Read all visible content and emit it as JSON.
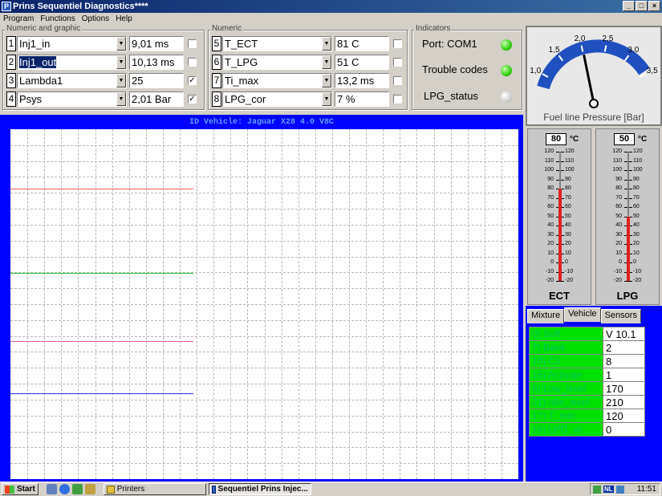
{
  "window": {
    "title": "Prins Sequentiel Diagnostics****",
    "title_icon_letter": "P",
    "min": "_",
    "max": "□",
    "close": "×"
  },
  "menu": [
    "Program",
    "Functions",
    "Options",
    "Help"
  ],
  "numeric_graphic": {
    "label": "Numeric and graphic",
    "rows": [
      {
        "idx": "1",
        "name": "Inj1_in",
        "value": "9,01 ms",
        "checked": false,
        "selected": false
      },
      {
        "idx": "2",
        "name": "Inj1_out",
        "value": "10,13 ms",
        "checked": false,
        "selected": true
      },
      {
        "idx": "3",
        "name": "Lambda1",
        "value": "25",
        "checked": true,
        "selected": false
      },
      {
        "idx": "4",
        "name": "Psys",
        "value": "2,01 Bar",
        "checked": true,
        "selected": false
      }
    ]
  },
  "numeric": {
    "label": "Numeric",
    "rows": [
      {
        "idx": "5",
        "name": "T_ECT",
        "value": "81 C",
        "checked": false
      },
      {
        "idx": "6",
        "name": "T_LPG",
        "value": "51 C",
        "checked": false
      },
      {
        "idx": "7",
        "name": "Ti_max",
        "value": "13,2 ms",
        "checked": false
      },
      {
        "idx": "8",
        "name": "LPG_cor",
        "value": "7 %",
        "checked": false
      }
    ]
  },
  "indicators": {
    "label": "Indicators",
    "items": [
      {
        "label": "Port: COM1",
        "state": "green"
      },
      {
        "label": "Trouble codes",
        "state": "green"
      },
      {
        "label": "LPG_status",
        "state": "off"
      }
    ]
  },
  "gauge": {
    "label": "Fuel line Pressure [Bar]",
    "ticks": [
      "1,0",
      "1,5",
      "2,0",
      "2,5",
      "3,0",
      "3,5"
    ],
    "value": 2.01,
    "min": 1.0,
    "max": 3.5
  },
  "chart": {
    "title": "ID Vehicle: Jaguar X28 4.0 V8C",
    "colors": {
      "bg": "#0000ff",
      "red": "#ff6060",
      "green": "#30c030",
      "pink": "#e060a0",
      "blue": "#3030e0"
    },
    "traces": [
      {
        "color": "red",
        "level": 0.83
      },
      {
        "color": "green",
        "level": 0.59
      },
      {
        "color": "pink",
        "level": 0.395
      },
      {
        "color": "blue",
        "level": 0.245
      }
    ]
  },
  "thermometers": [
    {
      "name": "ECT",
      "reading": "80",
      "unit": "°C",
      "value": 80
    },
    {
      "name": "LPG",
      "reading": "50",
      "unit": "°C",
      "value": 50
    }
  ],
  "thermo_scale": [
    "120",
    "110",
    "100",
    "90",
    "80",
    "70",
    "60",
    "50",
    "40",
    "30",
    "20",
    "10",
    "0",
    "-10",
    "-20"
  ],
  "tabs": [
    {
      "label": "Mixture",
      "active": false
    },
    {
      "label": "Vehicle",
      "active": true
    },
    {
      "label": "Sensors",
      "active": false
    }
  ],
  "params": [
    {
      "k": "0) Soft",
      "v": "V 10.1"
    },
    {
      "k": "7) Bank",
      "v": "2"
    },
    {
      "k": "10) Cil",
      "v": "8"
    },
    {
      "k": "15) Activate",
      "v": "1"
    },
    {
      "k": "6) Low_level",
      "v": "170"
    },
    {
      "k": "21) Idle_level",
      "v": "210"
    },
    {
      "k": "17) T_min",
      "v": "120"
    },
    {
      "k": "16) LPG_vc",
      "v": "0"
    }
  ],
  "taskbar": {
    "start": "Start",
    "buttons": [
      {
        "label": "Printers",
        "pressed": false
      },
      {
        "label": "Sequentiel Prins Injec...",
        "pressed": true
      }
    ],
    "time": "11:51",
    "tray": "NL"
  }
}
